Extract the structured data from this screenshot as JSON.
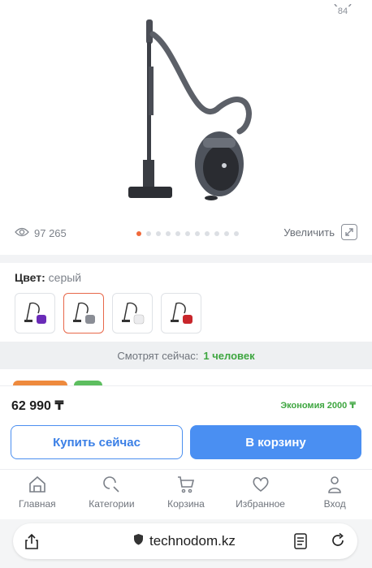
{
  "gallery": {
    "top_counter": "84",
    "views": "97 265",
    "dots_total": 11,
    "dots_active_index": 0,
    "zoom_label": "Увеличить"
  },
  "color": {
    "label": "Цвет:",
    "value": "серый",
    "swatches": [
      {
        "name": "purple",
        "accent": "#6a2bb8"
      },
      {
        "name": "gray",
        "accent": "#8a8d95"
      },
      {
        "name": "white",
        "accent": "#e8e8ea"
      },
      {
        "name": "red",
        "accent": "#c8262b"
      }
    ],
    "selected_index": 1
  },
  "watching": {
    "label": "Смотрят сейчас:",
    "count": "1 человек"
  },
  "price": {
    "value": "62 990 ₸",
    "saving": "Экономия 2000 ₸"
  },
  "buttons": {
    "buy_now": "Купить сейчас",
    "add_to_cart": "В корзину"
  },
  "nav": {
    "items": [
      {
        "label": "Главная",
        "icon": "home-icon"
      },
      {
        "label": "Категории",
        "icon": "categories-search-icon"
      },
      {
        "label": "Корзина",
        "icon": "cart-icon"
      },
      {
        "label": "Избранное",
        "icon": "heart-icon"
      },
      {
        "label": "Вход",
        "icon": "user-icon"
      }
    ]
  },
  "browser": {
    "host": "technodom.kz"
  },
  "colors": {
    "primary": "#4a8ff2",
    "accent_orange": "#f0693a",
    "success": "#3ea640"
  }
}
